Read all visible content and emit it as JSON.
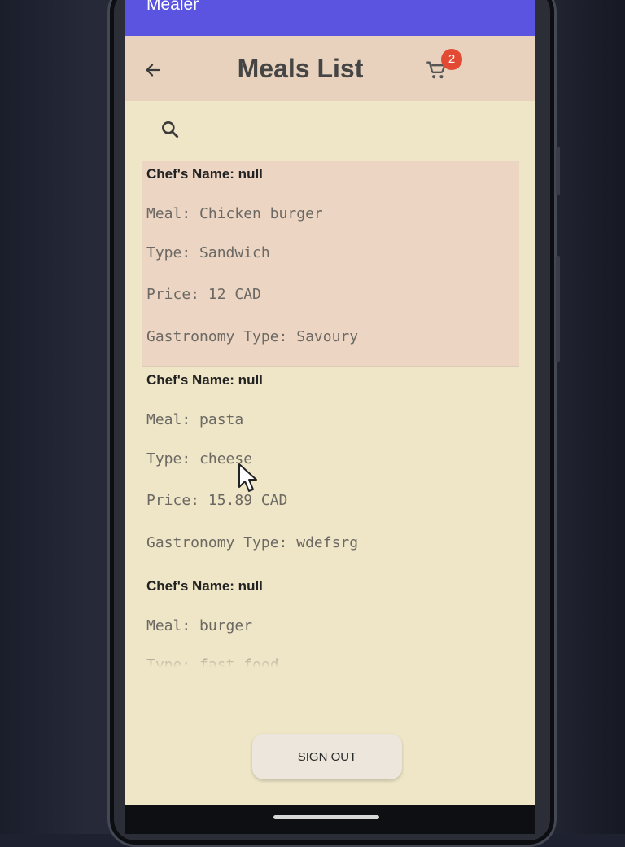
{
  "app": {
    "title": "Mealer"
  },
  "header": {
    "title": "Meals List",
    "cart_count": "2"
  },
  "meals": [
    {
      "chef": "Chef's Name: null",
      "meal": "Meal: Chicken burger",
      "type": "Type: Sandwich",
      "price": "Price: 12 CAD",
      "gastronomy": "Gastronomy Type: Savoury"
    },
    {
      "chef": "Chef's Name: null",
      "meal": "Meal: pasta",
      "type": "Type: cheese",
      "price": "Price: 15.89 CAD",
      "gastronomy": "Gastronomy Type: wdefsrg"
    },
    {
      "chef": "Chef's Name: null",
      "meal": "Meal: burger",
      "type": "Type: fast food",
      "price": "",
      "gastronomy": ""
    }
  ],
  "footer": {
    "signout_label": "SIGN OUT"
  },
  "icons": {
    "back": "arrow-left-icon",
    "cart": "shopping-cart-icon",
    "search": "search-icon"
  },
  "colors": {
    "app_bar": "#5a54e0",
    "header": "#e8d2bd",
    "background": "#efe6c7",
    "badge": "#e24a33"
  }
}
